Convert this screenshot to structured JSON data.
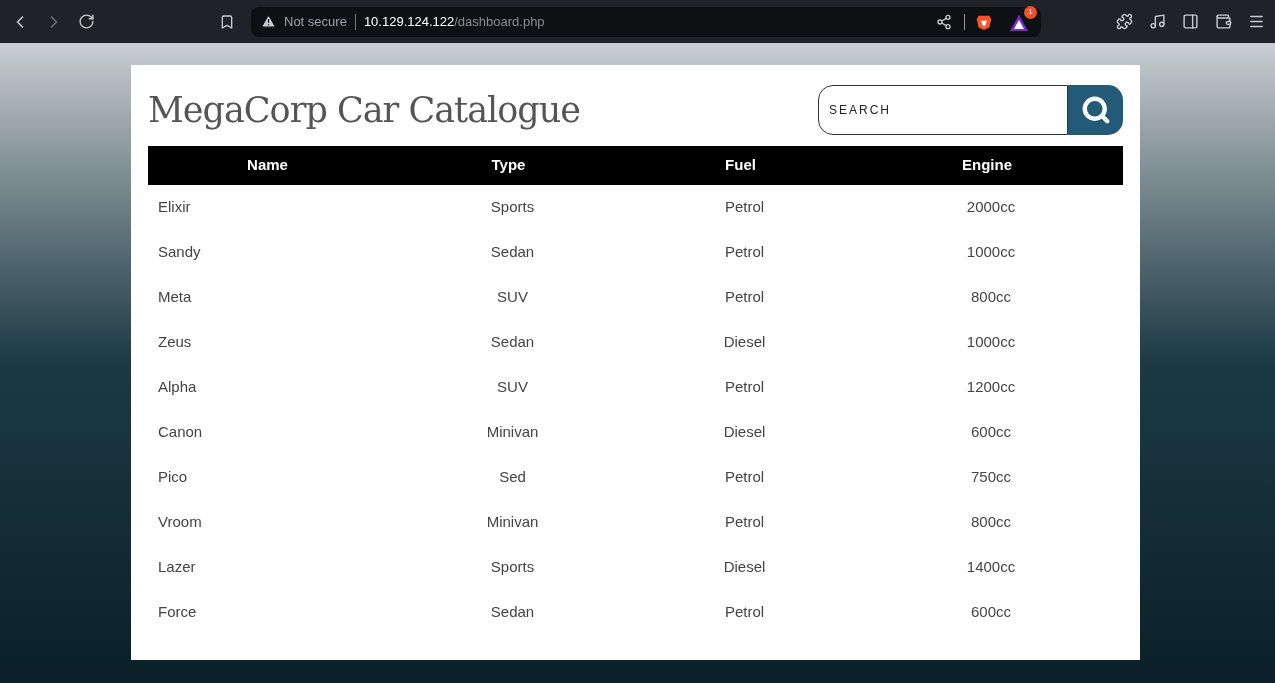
{
  "browser": {
    "security": "Not secure",
    "url_host": "10.129.124.122",
    "url_path": "/dashboard.php",
    "rewards_badge": "1"
  },
  "page": {
    "title": "MegaCorp Car Catalogue",
    "search": {
      "placeholder": "SEARCH"
    }
  },
  "table": {
    "columns": [
      "Name",
      "Type",
      "Fuel",
      "Engine"
    ],
    "rows": [
      [
        "Elixir",
        "Sports",
        "Petrol",
        "2000cc"
      ],
      [
        "Sandy",
        "Sedan",
        "Petrol",
        "1000cc"
      ],
      [
        "Meta",
        "SUV",
        "Petrol",
        "800cc"
      ],
      [
        "Zeus",
        "Sedan",
        "Diesel",
        "1000cc"
      ],
      [
        "Alpha",
        "SUV",
        "Petrol",
        "1200cc"
      ],
      [
        "Canon",
        "Minivan",
        "Diesel",
        "600cc"
      ],
      [
        "Pico",
        "Sed",
        "Petrol",
        "750cc"
      ],
      [
        "Vroom",
        "Minivan",
        "Petrol",
        "800cc"
      ],
      [
        "Lazer",
        "Sports",
        "Diesel",
        "1400cc"
      ],
      [
        "Force",
        "Sedan",
        "Petrol",
        "600cc"
      ]
    ]
  }
}
